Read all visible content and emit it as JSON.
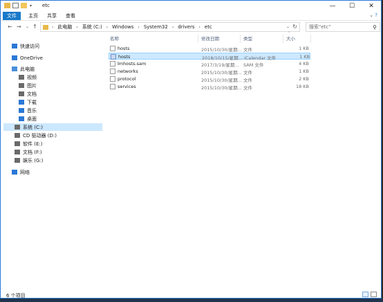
{
  "window": {
    "title": "etc",
    "controls": {
      "minimize": "—",
      "maximize": "☐",
      "close": "✕"
    }
  },
  "ribbon": {
    "tabs": [
      "文件",
      "主页",
      "共享",
      "查看"
    ]
  },
  "address": {
    "breadcrumbs": [
      "此电脑",
      "系统 (C:)",
      "Windows",
      "System32",
      "drivers",
      "etc"
    ],
    "search_placeholder": "搜索\"etc\""
  },
  "nav": {
    "items": [
      {
        "label": "快速访问",
        "icon": "star-icon",
        "color": "#2b78d6"
      },
      {
        "label": "OneDrive",
        "icon": "cloud-icon",
        "color": "#2b78d6"
      },
      {
        "label": "此电脑",
        "icon": "computer-icon",
        "color": "#4a90d9"
      },
      {
        "label": "视频",
        "icon": "video-folder-icon",
        "color": "#6a6a6a"
      },
      {
        "label": "图片",
        "icon": "pictures-folder-icon",
        "color": "#6a6a6a"
      },
      {
        "label": "文档",
        "icon": "documents-folder-icon",
        "color": "#6a6a6a"
      },
      {
        "label": "下载",
        "icon": "download-folder-icon",
        "color": "#2b78d6"
      },
      {
        "label": "音乐",
        "icon": "music-folder-icon",
        "color": "#2b78d6"
      },
      {
        "label": "桌面",
        "icon": "desktop-folder-icon",
        "color": "#2b78d6"
      },
      {
        "label": "系统 (C:)",
        "icon": "drive-icon",
        "color": "#6a6a6a"
      },
      {
        "label": "CD 驱动器 (D:)",
        "icon": "cd-drive-icon",
        "color": "#6a6a6a"
      },
      {
        "label": "软件 (E:)",
        "icon": "drive-icon",
        "color": "#6a6a6a"
      },
      {
        "label": "文档 (F:)",
        "icon": "drive-icon",
        "color": "#6a6a6a"
      },
      {
        "label": "娱乐 (G:)",
        "icon": "drive-icon",
        "color": "#6a6a6a"
      },
      {
        "label": "网络",
        "icon": "network-icon",
        "color": "#2b78d6"
      }
    ],
    "selected": "系统 (C:)"
  },
  "columns": {
    "name": "名称",
    "date": "修改日期",
    "type": "类型",
    "size": "大小"
  },
  "files": [
    {
      "name": "hosts",
      "date": "2015/10/30/星期...",
      "type": "文件",
      "size": "1 KB"
    },
    {
      "name": "hosts",
      "date": "2018/10/15/星期...",
      "type": "iCalendar 文件",
      "size": "1 KB"
    },
    {
      "name": "lmhosts.sam",
      "date": "2017/3/19/星期...",
      "type": "SAM 文件",
      "size": "4 KB"
    },
    {
      "name": "networks",
      "date": "2015/10/30/星期...",
      "type": "文件",
      "size": "1 KB"
    },
    {
      "name": "protocol",
      "date": "2015/10/30/星期...",
      "type": "文件",
      "size": "2 KB"
    },
    {
      "name": "services",
      "date": "2015/10/30/星期...",
      "type": "文件",
      "size": "18 KB"
    }
  ],
  "status": {
    "count": "6 个项目"
  }
}
